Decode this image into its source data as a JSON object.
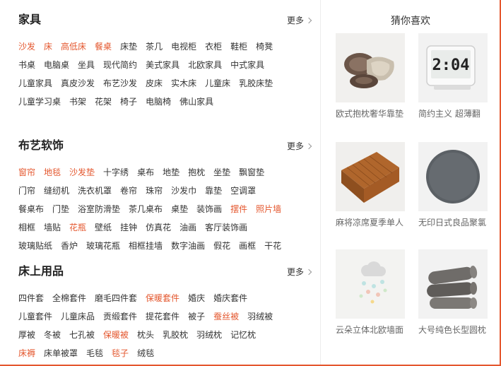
{
  "sections": [
    {
      "title": "家具",
      "more": "更多",
      "rows": [
        [
          {
            "t": "沙发",
            "hot": true
          },
          {
            "t": "床",
            "hot": true
          },
          {
            "t": "高低床",
            "hot": true
          },
          {
            "t": "餐桌",
            "hot": true
          },
          {
            "t": "床垫"
          },
          {
            "t": "茶几"
          },
          {
            "t": "电视柜"
          },
          {
            "t": "衣柜"
          },
          {
            "t": "鞋柜"
          },
          {
            "t": "椅凳"
          }
        ],
        [
          {
            "t": "书桌"
          },
          {
            "t": "电脑桌"
          },
          {
            "t": "坐具"
          },
          {
            "t": "现代简约"
          },
          {
            "t": "美式家具"
          },
          {
            "t": "北欧家具"
          },
          {
            "t": "中式家具"
          }
        ],
        [
          {
            "t": "儿童家具"
          },
          {
            "t": "真皮沙发"
          },
          {
            "t": "布艺沙发"
          },
          {
            "t": "皮床"
          },
          {
            "t": "实木床"
          },
          {
            "t": "儿童床"
          },
          {
            "t": "乳胶床垫"
          }
        ],
        [
          {
            "t": "儿童学习桌"
          },
          {
            "t": "书架"
          },
          {
            "t": "花架"
          },
          {
            "t": "椅子"
          },
          {
            "t": "电脑椅"
          },
          {
            "t": "佛山家具"
          }
        ]
      ]
    },
    {
      "title": "布艺软饰",
      "more": "更多",
      "rows": [
        [
          {
            "t": "窗帘",
            "hot": true
          },
          {
            "t": "地毯",
            "hot": true
          },
          {
            "t": "沙发垫",
            "hot": true
          },
          {
            "t": "十字绣"
          },
          {
            "t": "桌布"
          },
          {
            "t": "地垫"
          },
          {
            "t": "抱枕"
          },
          {
            "t": "坐垫"
          },
          {
            "t": "飘窗垫"
          }
        ],
        [
          {
            "t": "门帘"
          },
          {
            "t": "缝纫机"
          },
          {
            "t": "洗衣机罩"
          },
          {
            "t": "卷帘"
          },
          {
            "t": "珠帘"
          },
          {
            "t": "沙发巾"
          },
          {
            "t": "靠垫"
          },
          {
            "t": "空调罩"
          }
        ],
        [
          {
            "t": "餐桌布"
          },
          {
            "t": "门垫"
          },
          {
            "t": "浴室防滑垫"
          },
          {
            "t": "茶几桌布"
          },
          {
            "t": "桌垫"
          },
          {
            "t": "装饰画"
          },
          {
            "t": "摆件",
            "hot": true
          },
          {
            "t": "照片墙",
            "hot": true
          }
        ],
        [
          {
            "t": "相框"
          },
          {
            "t": "墙贴"
          },
          {
            "t": "花瓶",
            "hot": true
          },
          {
            "t": "壁纸"
          },
          {
            "t": "挂钟"
          },
          {
            "t": "仿真花"
          },
          {
            "t": "油画"
          },
          {
            "t": "客厅装饰画"
          }
        ],
        [
          {
            "t": "玻璃贴纸"
          },
          {
            "t": "香炉"
          },
          {
            "t": "玻璃花瓶"
          },
          {
            "t": "相框挂墙"
          },
          {
            "t": "数字油画"
          },
          {
            "t": "假花"
          },
          {
            "t": "画框"
          },
          {
            "t": "干花"
          }
        ]
      ]
    },
    {
      "title": "床上用品",
      "more": "更多",
      "rows": [
        [
          {
            "t": "四件套"
          },
          {
            "t": "全棉套件"
          },
          {
            "t": "磨毛四件套"
          },
          {
            "t": "保暖套件",
            "hot": true
          },
          {
            "t": "婚庆"
          },
          {
            "t": "婚庆套件"
          }
        ],
        [
          {
            "t": "儿童套件"
          },
          {
            "t": "儿童床品"
          },
          {
            "t": "贡缎套件"
          },
          {
            "t": "提花套件"
          },
          {
            "t": "被子"
          },
          {
            "t": "蚕丝被",
            "hot": true
          },
          {
            "t": "羽绒被"
          }
        ],
        [
          {
            "t": "厚被"
          },
          {
            "t": "冬被"
          },
          {
            "t": "七孔被"
          },
          {
            "t": "保暖被",
            "hot": true
          },
          {
            "t": "枕头"
          },
          {
            "t": "乳胶枕"
          },
          {
            "t": "羽绒枕"
          },
          {
            "t": "记忆枕"
          }
        ],
        [
          {
            "t": "床褥",
            "hot": true
          },
          {
            "t": "床单被罩"
          },
          {
            "t": "毛毯"
          },
          {
            "t": "毯子",
            "hot": true
          },
          {
            "t": "绒毯"
          }
        ]
      ]
    }
  ],
  "recommend": {
    "title": "猜你喜欢",
    "items": [
      {
        "caption": "欧式抱枕奢华靠垫",
        "icon": "pillows-image"
      },
      {
        "caption": "简约主义 超薄翻",
        "icon": "clock-image",
        "clock_text": "2:04"
      },
      {
        "caption": "麻将凉席夏季单人",
        "icon": "mat-image"
      },
      {
        "caption": "无印日式良品聚氯",
        "icon": "cushion-image"
      },
      {
        "caption": "云朵立体北欧墙面",
        "icon": "cloud-decor-image"
      },
      {
        "caption": "大号纯色长型圆枕",
        "icon": "bolster-image"
      }
    ]
  },
  "colors": {
    "accent": "#e4572e",
    "text": "#333333",
    "muted": "#666666"
  }
}
